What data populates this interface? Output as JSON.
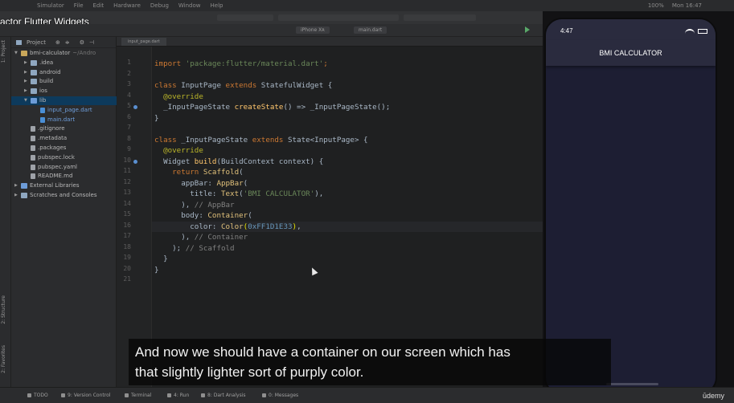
{
  "video_title": "actor Flutter Widgets",
  "menubar": {
    "items": [
      "Simulator",
      "File",
      "Edit",
      "Hardware",
      "Debug",
      "Window",
      "Help"
    ],
    "right": [
      "100%",
      "Mon 16:47"
    ]
  },
  "toolbar": {
    "device": "iPhone Xʀ",
    "config": "main.dart"
  },
  "project_panel": {
    "header": "Project",
    "tree": [
      {
        "label": "bmi-calculator",
        "suffix": "~/Andro",
        "icon": "module",
        "arrow": "▼",
        "level": 0
      },
      {
        "label": ".idea",
        "icon": "folder",
        "arrow": "▶",
        "level": 1
      },
      {
        "label": "android",
        "icon": "folder",
        "arrow": "▶",
        "level": 1
      },
      {
        "label": "build",
        "icon": "folder",
        "arrow": "▶",
        "level": 1
      },
      {
        "label": "ios",
        "icon": "folder",
        "arrow": "▶",
        "level": 1
      },
      {
        "label": "lib",
        "icon": "lib",
        "arrow": "▼",
        "level": 1,
        "selected": true
      },
      {
        "label": "input_page.dart",
        "icon": "dart",
        "arrow": "",
        "level": 2
      },
      {
        "label": "main.dart",
        "icon": "dart",
        "arrow": "",
        "level": 2
      },
      {
        "label": ".gitignore",
        "icon": "file",
        "arrow": "",
        "level": 1
      },
      {
        "label": ".metadata",
        "icon": "file",
        "arrow": "",
        "level": 1
      },
      {
        "label": ".packages",
        "icon": "file",
        "arrow": "",
        "level": 1
      },
      {
        "label": "pubspec.lock",
        "icon": "file",
        "arrow": "",
        "level": 1
      },
      {
        "label": "pubspec.yaml",
        "icon": "file",
        "arrow": "",
        "level": 1
      },
      {
        "label": "README.md",
        "icon": "file",
        "arrow": "",
        "level": 1
      },
      {
        "label": "External Libraries",
        "icon": "lib",
        "arrow": "▶",
        "level": 0
      },
      {
        "label": "Scratches and Consoles",
        "icon": "folder",
        "arrow": "▶",
        "level": 0
      }
    ]
  },
  "side_labels": {
    "project": "1: Project",
    "structure": "2: Structure",
    "favorites": "2: Favorites"
  },
  "editor": {
    "tab": "input_page.dart",
    "line_numbers": [
      "1",
      "2",
      "3",
      "4",
      "5",
      "6",
      "7",
      "8",
      "9",
      "10",
      "11",
      "12",
      "13",
      "14",
      "15",
      "16",
      "17",
      "18",
      "19",
      "20",
      "21"
    ],
    "gutter_marks": [
      5,
      10
    ],
    "current_line": 16,
    "code": [
      [
        {
          "t": "import ",
          "c": "kw"
        },
        {
          "t": "'package:flutter/material.dart'",
          "c": "str"
        },
        {
          "t": ";",
          "c": "kw"
        }
      ],
      [],
      [
        {
          "t": "class ",
          "c": "kw"
        },
        {
          "t": "InputPage ",
          "c": ""
        },
        {
          "t": "extends ",
          "c": "kw"
        },
        {
          "t": "StatefulWidget {",
          "c": ""
        }
      ],
      [
        {
          "t": "  @override",
          "c": "ann"
        }
      ],
      [
        {
          "t": "  _InputPageState ",
          "c": ""
        },
        {
          "t": "createState",
          "c": "fn"
        },
        {
          "t": "() => ",
          "c": ""
        },
        {
          "t": "_InputPageState",
          "c": ""
        },
        {
          "t": "();",
          "c": ""
        }
      ],
      [
        {
          "t": "}",
          "c": ""
        }
      ],
      [],
      [
        {
          "t": "class ",
          "c": "kw"
        },
        {
          "t": "_InputPageState ",
          "c": ""
        },
        {
          "t": "extends ",
          "c": "kw"
        },
        {
          "t": "State<InputPage> {",
          "c": ""
        }
      ],
      [
        {
          "t": "  @override",
          "c": "ann"
        }
      ],
      [
        {
          "t": "  Widget ",
          "c": ""
        },
        {
          "t": "build",
          "c": "fn"
        },
        {
          "t": "(BuildContext context) {",
          "c": ""
        }
      ],
      [
        {
          "t": "    return ",
          "c": "kw"
        },
        {
          "t": "Scaffold",
          "c": "typ"
        },
        {
          "t": "(",
          "c": ""
        }
      ],
      [
        {
          "t": "      appBar: ",
          "c": ""
        },
        {
          "t": "AppBar",
          "c": "typ"
        },
        {
          "t": "(",
          "c": ""
        }
      ],
      [
        {
          "t": "        title: ",
          "c": ""
        },
        {
          "t": "Text",
          "c": "typ"
        },
        {
          "t": "(",
          "c": ""
        },
        {
          "t": "'BMI CALCULATOR'",
          "c": "str"
        },
        {
          "t": "),",
          "c": ""
        }
      ],
      [
        {
          "t": "      ), ",
          "c": ""
        },
        {
          "t": "// AppBar",
          "c": "cmt"
        }
      ],
      [
        {
          "t": "      body: ",
          "c": ""
        },
        {
          "t": "Container",
          "c": "typ"
        },
        {
          "t": "(",
          "c": ""
        }
      ],
      [
        {
          "t": "        color: ",
          "c": ""
        },
        {
          "t": "Color",
          "c": "typ"
        },
        {
          "t": "(",
          "c": "br"
        },
        {
          "t": "0xFF1D1E33",
          "c": "num"
        },
        {
          "t": ")",
          "c": "br"
        },
        {
          "t": ",",
          "c": ""
        }
      ],
      [
        {
          "t": "      ), ",
          "c": ""
        },
        {
          "t": "// Container",
          "c": "cmt"
        }
      ],
      [
        {
          "t": "    ); ",
          "c": ""
        },
        {
          "t": "// Scaffold",
          "c": "cmt"
        }
      ],
      [
        {
          "t": "  }",
          "c": ""
        }
      ],
      [
        {
          "t": "}",
          "c": ""
        }
      ],
      []
    ]
  },
  "bottom_bar": {
    "items": [
      "TODO",
      "9: Version Control",
      "Terminal",
      "4: Run",
      "8: Dart Analysis",
      "0: Messages"
    ],
    "brand": "ūdemy"
  },
  "simulator": {
    "time": "4:47",
    "app_title": "BMI CALCULATOR",
    "body_color": "#1D1E33",
    "appbar_color": "#2A2B3E"
  },
  "subtitle": {
    "line1": "And now we should have a container on our screen which has",
    "line2": "that slightly lighter sort of purply color."
  },
  "colors": {
    "keyword": "#cc7832",
    "string": "#6a8759",
    "comment": "#808080",
    "number": "#6897bb"
  }
}
